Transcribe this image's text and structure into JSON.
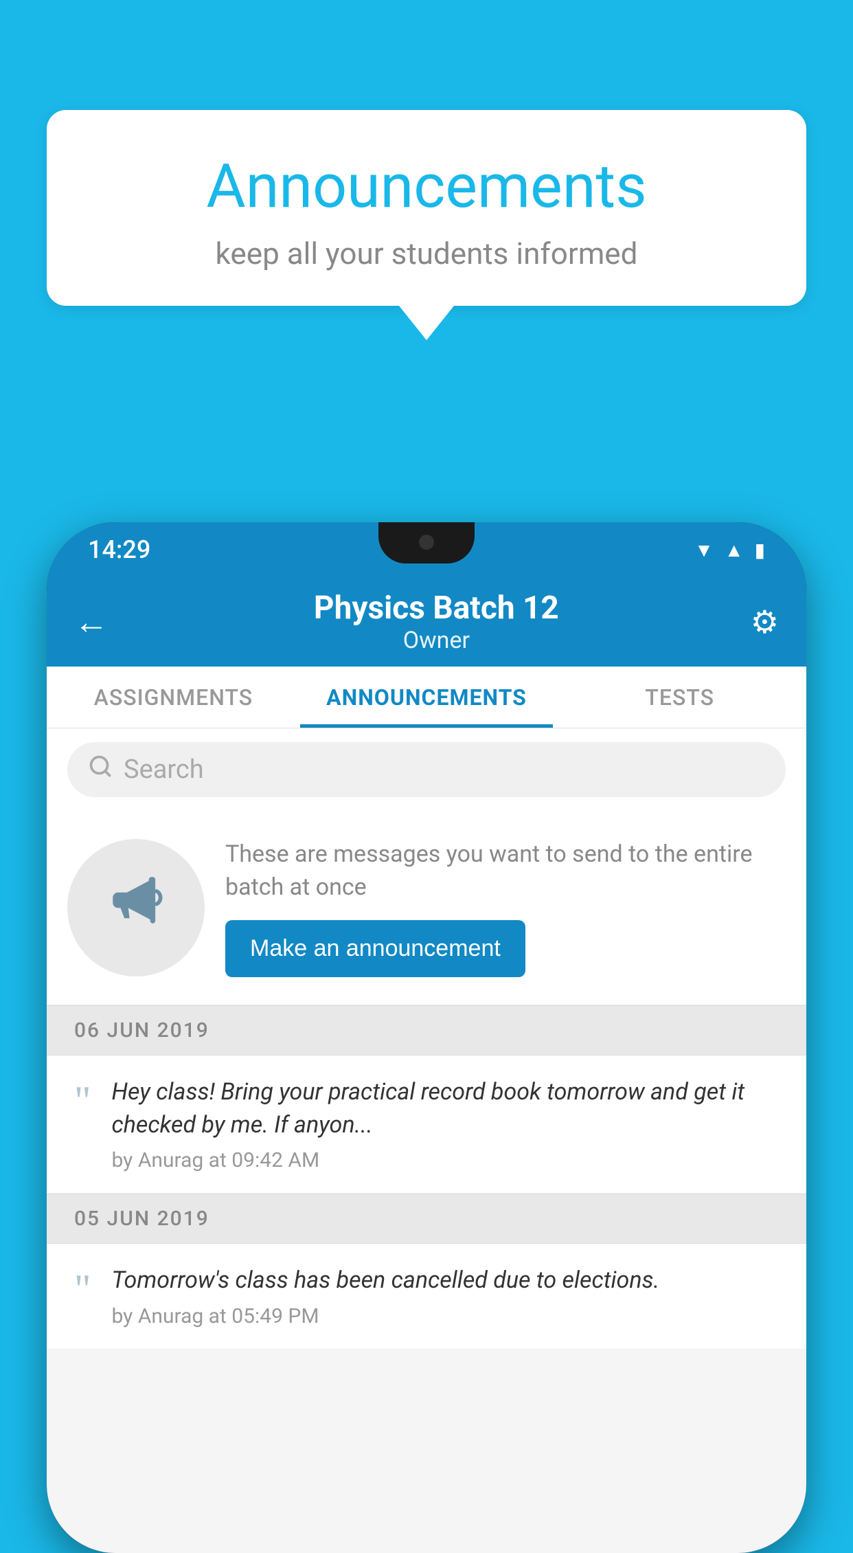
{
  "background_color": "#1ab8e8",
  "speech_bubble": {
    "title": "Announcements",
    "subtitle": "keep all your students informed"
  },
  "phone": {
    "status_bar": {
      "time": "14:29",
      "wifi_icon": "wifi",
      "signal_icon": "signal",
      "battery_icon": "battery"
    },
    "header": {
      "title": "Physics Batch 12",
      "subtitle": "Owner",
      "back_label": "←",
      "gear_label": "⚙"
    },
    "tabs": [
      {
        "label": "ASSIGNMENTS",
        "active": false
      },
      {
        "label": "ANNOUNCEMENTS",
        "active": true
      },
      {
        "label": "TESTS",
        "active": false
      }
    ],
    "search": {
      "placeholder": "Search"
    },
    "announcement_prompt": {
      "description_text": "These are messages you want to send to the entire batch at once",
      "button_label": "Make an announcement"
    },
    "announcements": [
      {
        "date": "06  JUN  2019",
        "message": "Hey class! Bring your practical record book tomorrow and get it checked by me. If anyon...",
        "meta": "by Anurag at 09:42 AM"
      },
      {
        "date": "05  JUN  2019",
        "message": "Tomorrow's class has been cancelled due to elections.",
        "meta": "by Anurag at 05:49 PM"
      }
    ]
  }
}
